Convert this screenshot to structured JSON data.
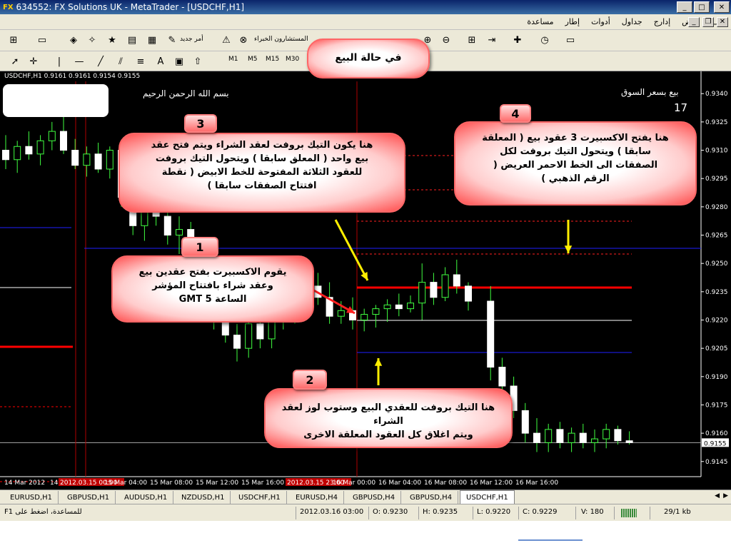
{
  "window": {
    "logo": "FX",
    "title": "634552: FX Solutions UK - MetaTrader - [USDCHF,H1]"
  },
  "menu": [
    "ملف",
    "عرض",
    "إدارج",
    "جداول",
    "أدوات",
    "إطار",
    "مساعدة"
  ],
  "toolbar": {
    "new_order": "أمر جديد",
    "experts": "المستشارون الخبراء",
    "timeframes": [
      "M1",
      "M5",
      "M15",
      "M30"
    ]
  },
  "chart": {
    "header": "USDCHF,H1  0.9161 0.9161 0.9154 0.9155",
    "basmala": "بسم الله الرحمن الرحيم",
    "sell_market": "بيع بسعر السوق",
    "sell_market_count": "17",
    "price_axis": [
      "0.9340",
      "0.9325",
      "0.9310",
      "0.9295",
      "0.9280",
      "0.9265",
      "0.9250",
      "0.9235",
      "0.9220",
      "0.9205",
      "0.9190",
      "0.9175",
      "0.9160",
      "0.9145"
    ],
    "current_price": "0.9155",
    "time_axis": [
      "14 Mar 2012",
      "14 Mar 20",
      "2012.03.15 00:00",
      "15 Mar 04:00",
      "15 Mar 08:00",
      "15 Mar 12:00",
      "15 Mar 16:00",
      "2012.03.15 23:00",
      "16 Mar 00:00",
      "16 Mar 04:00",
      "16 Mar 08:00",
      "16 Mar 12:00",
      "16 Mar 16:00"
    ]
  },
  "callouts": {
    "sell_state": "في حالة البيع",
    "c1_num": "1",
    "c1_text": [
      "يقوم الاكسبيرت بفتح عقدين بيع",
      "وعقد شراء بافتتاح المؤشر",
      "الساعة 5 GMT"
    ],
    "c2_num": "2",
    "c2_text": [
      "هنا التيك بروفت للعقدي البيع وستوب لوز لعقد",
      "الشراء",
      "ويتم اغلاق كل العقود المعلقة الاخرى"
    ],
    "c3_num": "3",
    "c3_text": [
      "هنا يكون التيك بروفت لعقد الشراء ويتم فتح عقد",
      "بيع واحد ( المعلق سابقا ) ويتحول التيك بروفت",
      "للعقود الثلاثة المفتوحة للخط الابيض ( نقطة",
      "افتتاح الصفقات سابقا )"
    ],
    "c4_num": "4",
    "c4_text": [
      "هنا يفتح الاكسبيرت 3 عقود بيع ( المعلقة",
      "سابقا )  ويتحول التيك بروفت لكل",
      "الصفقات الى الخط الاحمر العريض (",
      "الرقم الذهبي )"
    ]
  },
  "tabs": [
    "EURUSD,H1",
    "GBPUSD,H1",
    "AUDUSD,H1",
    "NZDUSD,H1",
    "USDCHF,H1",
    "EURUSD,H4",
    "GBPUSD,H4",
    "GBPUSD,H4",
    "USDCHF,H1"
  ],
  "active_tab": 8,
  "status": {
    "help": "للمساعدة، اضغط على F1",
    "datetime": "2012.03.16 03:00",
    "open": "O: 0.9230",
    "high": "H: 0.9235",
    "low": "L: 0.9220",
    "close": "C: 0.9229",
    "volume": "V: 180",
    "traffic": "29/1 kb"
  },
  "candles": [
    {
      "o": 0.931,
      "h": 0.9318,
      "l": 0.93,
      "c": 0.9305
    },
    {
      "o": 0.9305,
      "h": 0.9315,
      "l": 0.9298,
      "c": 0.9312
    },
    {
      "o": 0.9312,
      "h": 0.932,
      "l": 0.9305,
      "c": 0.9308
    },
    {
      "o": 0.9308,
      "h": 0.9318,
      "l": 0.9302,
      "c": 0.9315
    },
    {
      "o": 0.9315,
      "h": 0.9325,
      "l": 0.931,
      "c": 0.932
    },
    {
      "o": 0.932,
      "h": 0.933,
      "l": 0.9308,
      "c": 0.931
    },
    {
      "o": 0.931,
      "h": 0.9316,
      "l": 0.93,
      "c": 0.9302
    },
    {
      "o": 0.9302,
      "h": 0.9312,
      "l": 0.9296,
      "c": 0.9308
    },
    {
      "o": 0.9308,
      "h": 0.9314,
      "l": 0.9298,
      "c": 0.93
    },
    {
      "o": 0.93,
      "h": 0.9312,
      "l": 0.9295,
      "c": 0.931
    },
    {
      "o": 0.931,
      "h": 0.9315,
      "l": 0.928,
      "c": 0.9285
    },
    {
      "o": 0.9285,
      "h": 0.9295,
      "l": 0.9265,
      "c": 0.927
    },
    {
      "o": 0.927,
      "h": 0.9285,
      "l": 0.9262,
      "c": 0.928
    },
    {
      "o": 0.928,
      "h": 0.9288,
      "l": 0.927,
      "c": 0.9275
    },
    {
      "o": 0.9275,
      "h": 0.9282,
      "l": 0.926,
      "c": 0.9265
    },
    {
      "o": 0.9265,
      "h": 0.9275,
      "l": 0.9255,
      "c": 0.9268
    },
    {
      "o": 0.9268,
      "h": 0.9272,
      "l": 0.924,
      "c": 0.9245
    },
    {
      "o": 0.9245,
      "h": 0.925,
      "l": 0.923,
      "c": 0.9235
    },
    {
      "o": 0.9235,
      "h": 0.924,
      "l": 0.9215,
      "c": 0.922
    },
    {
      "o": 0.922,
      "h": 0.9226,
      "l": 0.9208,
      "c": 0.9212
    },
    {
      "o": 0.9212,
      "h": 0.9218,
      "l": 0.9198,
      "c": 0.9205
    },
    {
      "o": 0.9205,
      "h": 0.9222,
      "l": 0.92,
      "c": 0.9218
    },
    {
      "o": 0.9218,
      "h": 0.9225,
      "l": 0.9205,
      "c": 0.921
    },
    {
      "o": 0.921,
      "h": 0.9225,
      "l": 0.9205,
      "c": 0.9222
    },
    {
      "o": 0.9222,
      "h": 0.923,
      "l": 0.9215,
      "c": 0.9226
    },
    {
      "o": 0.9226,
      "h": 0.9235,
      "l": 0.9218,
      "c": 0.923
    },
    {
      "o": 0.923,
      "h": 0.9242,
      "l": 0.9225,
      "c": 0.9238
    },
    {
      "o": 0.9238,
      "h": 0.9245,
      "l": 0.9228,
      "c": 0.9232
    },
    {
      "o": 0.9232,
      "h": 0.924,
      "l": 0.9218,
      "c": 0.9222
    },
    {
      "o": 0.9222,
      "h": 0.923,
      "l": 0.9218,
      "c": 0.9225
    },
    {
      "o": 0.9225,
      "h": 0.9232,
      "l": 0.9215,
      "c": 0.922
    },
    {
      "o": 0.922,
      "h": 0.9226,
      "l": 0.9214,
      "c": 0.9223
    },
    {
      "o": 0.9223,
      "h": 0.9228,
      "l": 0.9216,
      "c": 0.9226
    },
    {
      "o": 0.9226,
      "h": 0.9231,
      "l": 0.9219,
      "c": 0.9228
    },
    {
      "o": 0.9228,
      "h": 0.9234,
      "l": 0.9222,
      "c": 0.9226
    },
    {
      "o": 0.9226,
      "h": 0.9233,
      "l": 0.9224,
      "c": 0.9229
    },
    {
      "o": 0.9229,
      "h": 0.925,
      "l": 0.922,
      "c": 0.924
    },
    {
      "o": 0.924,
      "h": 0.9245,
      "l": 0.9228,
      "c": 0.9232
    },
    {
      "o": 0.9232,
      "h": 0.9248,
      "l": 0.923,
      "c": 0.9244
    },
    {
      "o": 0.9244,
      "h": 0.9252,
      "l": 0.9234,
      "c": 0.9238
    },
    {
      "o": 0.9238,
      "h": 0.924,
      "l": 0.9225,
      "c": 0.923
    },
    {
      "o": 0.923,
      "h": 0.9238,
      "l": 0.9188,
      "c": 0.9195
    },
    {
      "o": 0.9195,
      "h": 0.92,
      "l": 0.918,
      "c": 0.9185
    },
    {
      "o": 0.9185,
      "h": 0.919,
      "l": 0.9168,
      "c": 0.9172
    },
    {
      "o": 0.9172,
      "h": 0.9176,
      "l": 0.9155,
      "c": 0.916
    },
    {
      "o": 0.916,
      "h": 0.9168,
      "l": 0.915,
      "c": 0.9155
    },
    {
      "o": 0.9155,
      "h": 0.9165,
      "l": 0.915,
      "c": 0.9162
    },
    {
      "o": 0.9162,
      "h": 0.9166,
      "l": 0.9152,
      "c": 0.9155
    },
    {
      "o": 0.9155,
      "h": 0.9163,
      "l": 0.915,
      "c": 0.916
    },
    {
      "o": 0.916,
      "h": 0.9165,
      "l": 0.9152,
      "c": 0.9155
    },
    {
      "o": 0.9155,
      "h": 0.9162,
      "l": 0.915,
      "c": 0.9157
    },
    {
      "o": 0.9157,
      "h": 0.9165,
      "l": 0.9152,
      "c": 0.9162
    },
    {
      "o": 0.9162,
      "h": 0.9164,
      "l": 0.9154,
      "c": 0.9156
    },
    {
      "o": 0.9156,
      "h": 0.9161,
      "l": 0.9154,
      "c": 0.9155
    }
  ]
}
